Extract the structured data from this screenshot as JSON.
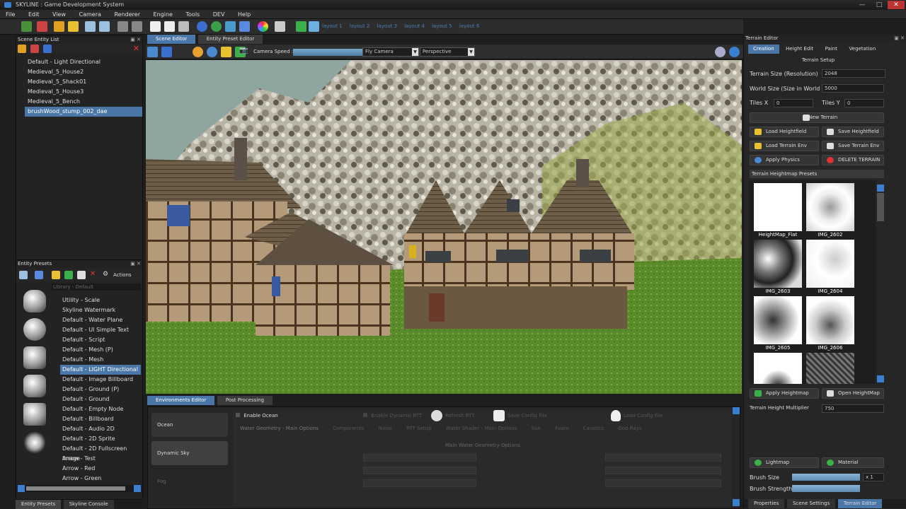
{
  "window": {
    "title": "SKYLINE : Game Development System",
    "minimize": "—",
    "maximize": "□",
    "close": "✕"
  },
  "menu": [
    "File",
    "Edit",
    "View",
    "Camera",
    "Renderer",
    "Engine",
    "Tools",
    "DEV",
    "Help"
  ],
  "toolbar": {
    "layouts": [
      "layout 1",
      "layout 2",
      "layout 3",
      "layout 4",
      "layout 5",
      "layout 6"
    ]
  },
  "scene_entity_list": {
    "title": "Scene Entity List",
    "items": [
      "Default - Light  Directional",
      "Medieval_5_House2",
      "Medieval_5_Shack01",
      "Medieval_5_House3",
      "Medieval_5_Bench",
      "brushWood_stump_002_dae"
    ],
    "selected_index": 5
  },
  "entity_presets": {
    "title": "Entity Presets",
    "actions_label": "Actions",
    "library": "Library - Default",
    "items": [
      "Utility - Scale",
      "Skyline Watermark",
      "Default - Water Plane",
      "Default - UI Simple Text",
      "Default - Script",
      "Default - Mesh (P)",
      "Default - Mesh",
      "Default - LIGHT Directional",
      "Default - Image Billboard",
      "Default - Ground (P)",
      "Default - Ground",
      "Default - Empty Node",
      "Default - Billboard",
      "Default - Audio 2D",
      "Default - 2D Sprite",
      "Default - 2D Fullscreen Image",
      "Arrow - Test",
      "Arrow - Red",
      "Arrow - Green"
    ],
    "selected_index": 7
  },
  "bottom_left_tabs": [
    "Entity Presets",
    "Skyline Console"
  ],
  "editor_tabs": [
    "Scene Editor",
    "Entity Preset Editor"
  ],
  "viewport_toolbar": {
    "camera_speed_label": "Camera Speed :",
    "camera_mode": "Fly Camera",
    "projection": "Perspective"
  },
  "env_tabs": [
    "Environments Editor",
    "Post Processing"
  ],
  "env_left_items": [
    "Ocean",
    "Dynamic Sky",
    "Fog"
  ],
  "env_top": {
    "enable_ocean": "Enable Ocean",
    "enable_rtt": "Enable Dynamic RTT",
    "refresh_rtt": "Refresh RTT",
    "save_config": "Save Config File",
    "load_config": "Load Config File"
  },
  "water_tabs": [
    "Water Geometry - Main Options",
    "Components",
    "Noise",
    "RTT Setup",
    "Water Shader - Main Options",
    "Sun",
    "Foam",
    "Caustics",
    "God Rays"
  ],
  "water_section_title": "Main Water Geometry Options",
  "terrain": {
    "panel_title": "Terrain Editor",
    "tabs": [
      "Creation",
      "Height Edit",
      "Paint",
      "Vegetation"
    ],
    "setup_title": "Terrain Setup",
    "size_label": "Terrain Size (Resolution)",
    "size_value": "2048",
    "world_label": "World Size (Size in World",
    "world_value": "5000",
    "tiles_x_label": "Tiles X",
    "tiles_x_value": "0",
    "tiles_y_label": "Tiles Y",
    "tiles_y_value": "0",
    "new_terrain": "New Terrain",
    "load_heightfield": "Load Heightfield",
    "save_heightfield": "Save Heightfield",
    "load_env": "Load Terrain Env",
    "save_env": "Save Terrain Env",
    "apply_physics": "Apply Physics",
    "delete_terrain": "DELETE TERRAIN",
    "presets_title": "Terrain Heightmap Presets",
    "presets": [
      "HeightMap_Flat",
      "IMG_2602",
      "IMG_2603",
      "IMG_2604",
      "IMG_2605",
      "IMG_2606"
    ],
    "apply_heightmap": "Apply Heightmap",
    "open_heightmap": "Open HeightMap",
    "multiplier_label": "Terrain Height Multiplier",
    "multiplier_value": "750",
    "lightmap": "Lightmap",
    "material": "Material",
    "brush_size_label": "Brush Size",
    "brush_size_mult": "x 1",
    "brush_strength_label": "Brush Strength",
    "bottom_tabs": [
      "Properties",
      "Scene Settings",
      "Terrain Editor"
    ]
  },
  "colors": {
    "accent": "#4b77a8",
    "panel": "#262626"
  }
}
